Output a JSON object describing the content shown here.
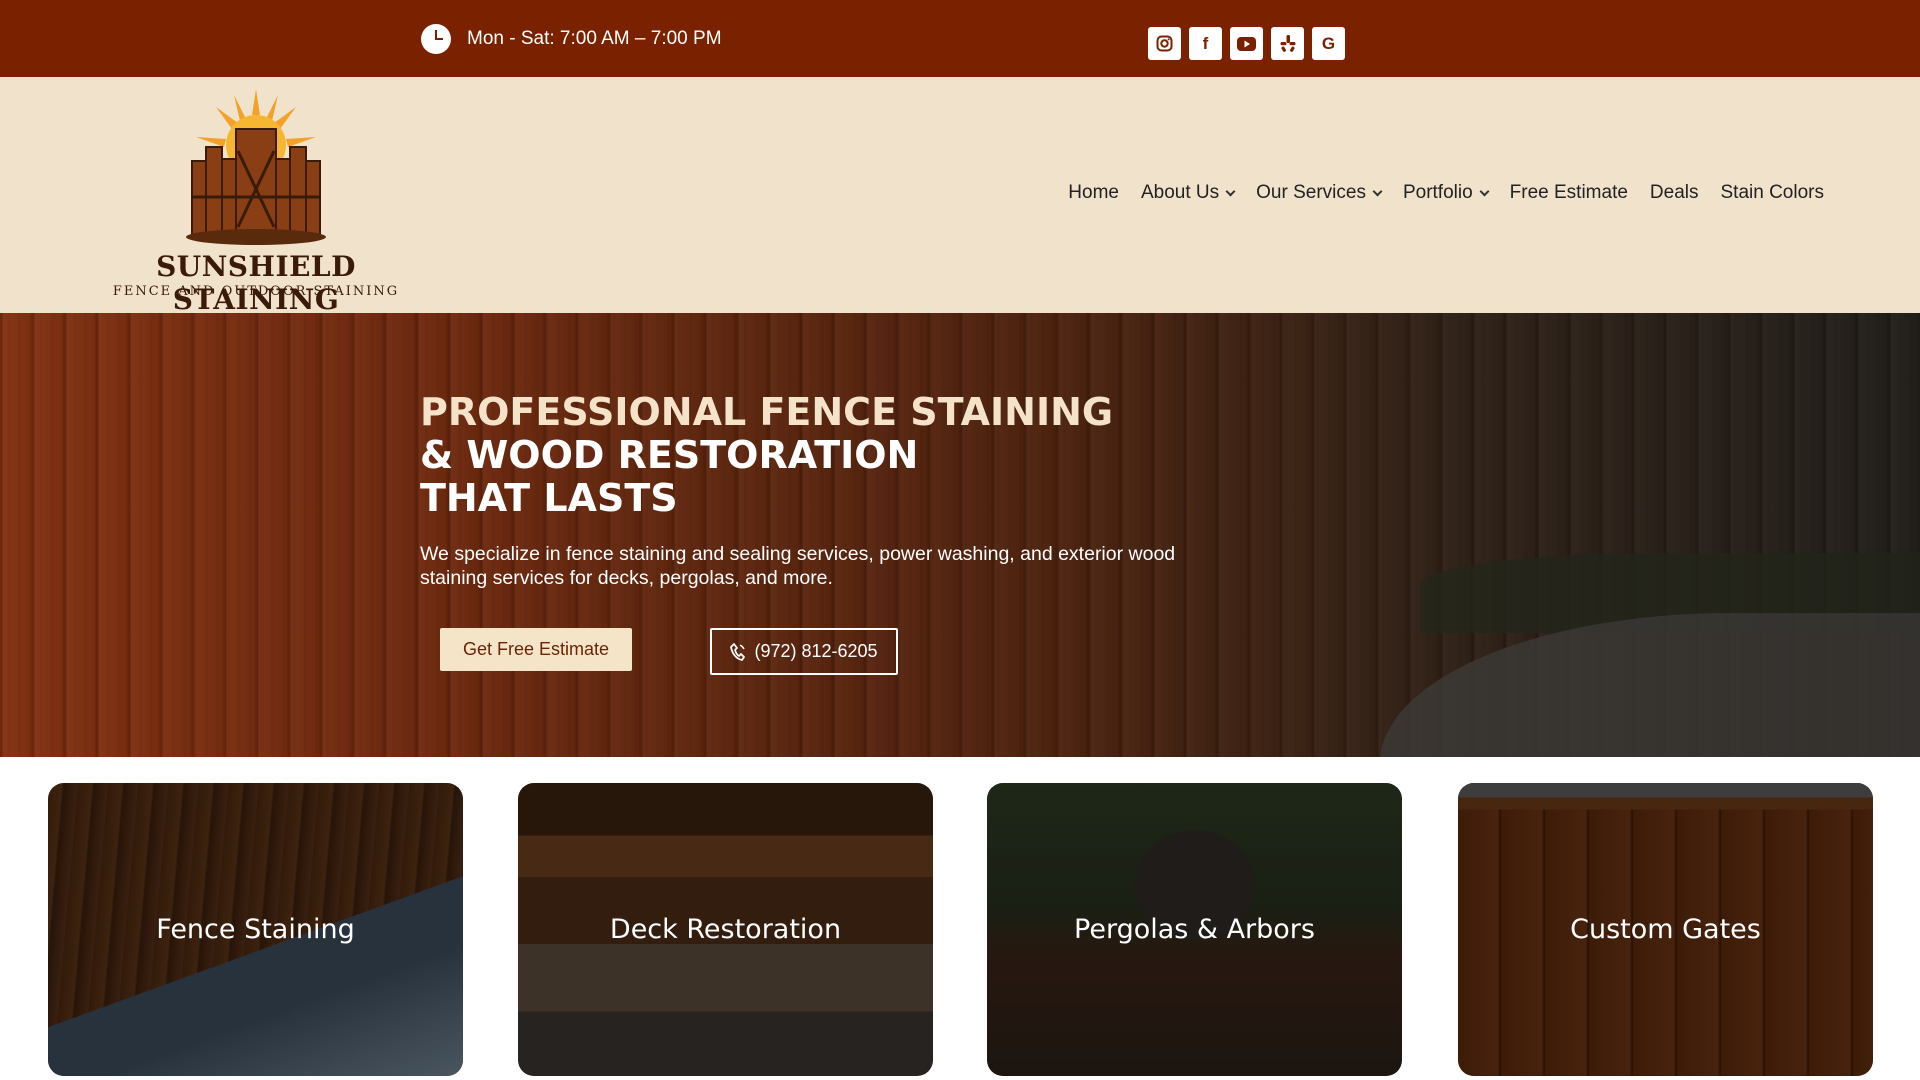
{
  "topbar": {
    "hours": "Mon - Sat: 7:00 AM – 7:00 PM",
    "socials": [
      {
        "icon": "instagram-icon",
        "label": ""
      },
      {
        "icon": "facebook-icon",
        "label": "f"
      },
      {
        "icon": "youtube-icon",
        "label": ""
      },
      {
        "icon": "yelp-icon",
        "label": ""
      },
      {
        "icon": "google-icon",
        "label": "G"
      }
    ]
  },
  "header": {
    "logo_name": "SUNSHIELD STAINING",
    "logo_tagline": "FENCE AND OUTDOOR STAINING",
    "nav": {
      "home": "Home",
      "about": "About Us",
      "services": "Our Services",
      "portfolio": "Portfolio",
      "estimate": "Free Estimate",
      "deals": "Deals",
      "stain_colors": "Stain Colors"
    }
  },
  "hero": {
    "title_line1": "PROFESSIONAL FENCE STAINING",
    "title_line2": "& WOOD RESTORATION",
    "title_line3": "THAT LASTS",
    "subtitle": "We specialize in fence staining and sealing services, power washing, and exterior wood staining services for decks, pergolas, and more.",
    "cta_estimate": "Get Free Estimate",
    "cta_phone": "(972) 812-6205"
  },
  "services": [
    {
      "label": "Fence Staining"
    },
    {
      "label": "Deck Restoration"
    },
    {
      "label": "Pergolas & Arbors"
    },
    {
      "label": "Custom Gates"
    }
  ],
  "colors": {
    "topbar_bg": "#7a2200",
    "header_bg": "#f1e3cb",
    "estimate_btn_bg": "#f4e5c9",
    "estimate_btn_text": "#6b2406"
  }
}
